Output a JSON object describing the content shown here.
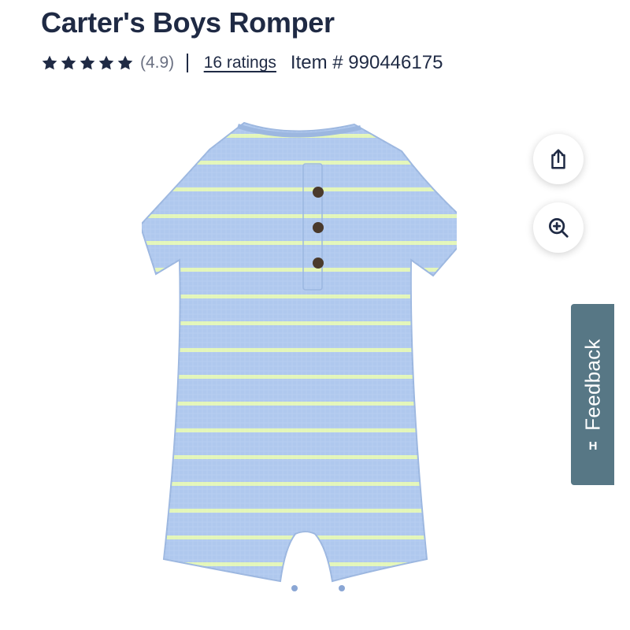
{
  "product": {
    "title": "Carter's Boys Romper",
    "rating_value": "(4.9)",
    "rating_score": 4.9,
    "star_count": 5,
    "ratings_link": "16 ratings",
    "item_number": "Item # 990446175"
  },
  "image": {
    "alt": "Blue and lime striped waffle-knit short-sleeve henley romper",
    "colors": {
      "body": "#afc8ee",
      "stripe": "#e3f6b8",
      "button": "#4a3a2c"
    }
  },
  "actions": {
    "share_icon": "share-icon",
    "zoom_icon": "zoom-in-icon"
  },
  "feedback": {
    "label": "Feedback",
    "logo": "H"
  },
  "colors": {
    "text": "#1f2a44",
    "muted": "#6a7082",
    "feedback_bg": "#577785",
    "star": "#1f2a44"
  }
}
